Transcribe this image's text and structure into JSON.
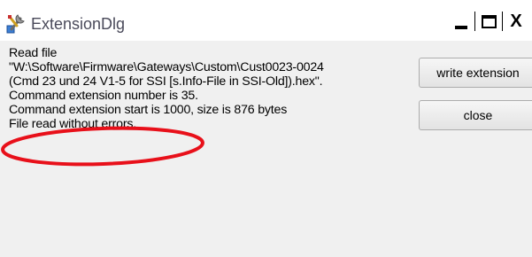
{
  "window": {
    "title": "ExtensionDlg",
    "caption_buttons": {
      "minimize": "_",
      "maximize": "□",
      "close": "X"
    }
  },
  "log": {
    "lines": [
      "Read file",
      "\"W:\\Software\\Firmware\\Gateways\\Custom\\Cust0023-0024",
      "(Cmd 23 und 24 V1-5 for SSI [s.Info-File in SSI-Old]).hex\".",
      "Command extension number is 35.",
      "Command extension start is 1000, size is 876 bytes",
      "File read without errors."
    ]
  },
  "buttons": {
    "write_extension": "write extension",
    "close": "close"
  },
  "annotation": {
    "color": "#e8101a"
  }
}
